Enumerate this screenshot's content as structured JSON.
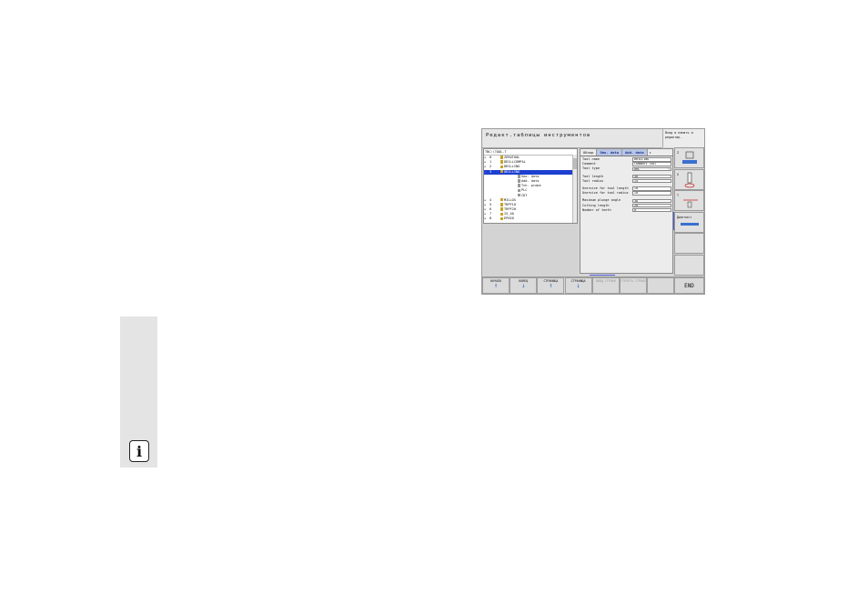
{
  "header": {
    "title": "Редакт.таблицы инструментов",
    "right_text": "Вход в память и редактир."
  },
  "tree": {
    "path": "TNC:\\TOOL.T",
    "rows": [
      {
        "expand": "+",
        "num": "0",
        "name": "ZEROTOOL",
        "icon": "tool",
        "selected": false
      },
      {
        "expand": "+",
        "num": "1",
        "name": "DRILLCOMPAL",
        "icon": "tool",
        "selected": false
      },
      {
        "expand": "+",
        "num": "2",
        "name": "DRILLING",
        "icon": "tool",
        "selected": false
      },
      {
        "expand": "-",
        "num": "3",
        "name": "DRILLING",
        "icon": "tool",
        "selected": true
      },
      {
        "expand": "",
        "num": "",
        "name": "Geo. data",
        "icon": "leaf",
        "selected": false
      },
      {
        "expand": "",
        "num": "",
        "name": "Add. data",
        "icon": "leaf",
        "selected": false
      },
      {
        "expand": "",
        "num": "",
        "name": "Tch. probe",
        "icon": "leaf",
        "selected": false
      },
      {
        "expand": "",
        "num": "",
        "name": "PLC",
        "icon": "leaf",
        "selected": false
      },
      {
        "expand": "",
        "num": "",
        "name": "CDT",
        "icon": "leaf",
        "selected": false
      },
      {
        "expand": "+",
        "num": "4",
        "name": "MILLOS",
        "icon": "tool",
        "selected": false
      },
      {
        "expand": "+",
        "num": "5",
        "name": "TRPF10",
        "icon": "tool",
        "selected": false
      },
      {
        "expand": "+",
        "num": "6",
        "name": "TRPF20",
        "icon": "tool",
        "selected": false
      },
      {
        "expand": "+",
        "num": "7",
        "name": "IS_40",
        "icon": "tool",
        "selected": false
      },
      {
        "expand": "+",
        "num": "8",
        "name": "EP020",
        "icon": "tool",
        "selected": false
      }
    ]
  },
  "detail": {
    "tabs": [
      {
        "label": "Обзор",
        "active": true
      },
      {
        "label": "Geo. data",
        "active": false
      },
      {
        "label": "Add. data",
        "active": false
      }
    ],
    "tab_more": "▸",
    "group1": [
      {
        "label": "Tool name",
        "value": "DRILLING",
        "dropdown": false
      },
      {
        "label": "Comment",
        "value": "Comment Tool",
        "dropdown": false
      },
      {
        "label": "Tool type",
        "value": "DRL",
        "dropdown": true
      }
    ],
    "group2": [
      {
        "label": "Tool length",
        "value": "40"
      },
      {
        "label": "Tool radius",
        "value": "+5"
      }
    ],
    "group3": [
      {
        "label": "Oversize for tool length",
        "value": "+0"
      },
      {
        "label": "Oversize for tool radius",
        "value": "+0"
      }
    ],
    "group4": [
      {
        "label": "Maximum plunge angle",
        "value": "30"
      },
      {
        "label": "Cutting length",
        "value": "20"
      },
      {
        "label": "Number of teeth",
        "value": "0"
      }
    ]
  },
  "right_softkeys": [
    {
      "label": "Z"
    },
    {
      "label": "X"
    },
    {
      "label": "T"
    },
    {
      "label": "Диагност"
    },
    {
      "label": ""
    },
    {
      "label": ""
    }
  ],
  "bottom_softkeys": [
    {
      "label": "НАЧАЛО",
      "arrow": "up",
      "disabled": false
    },
    {
      "label": "КОНЕЦ",
      "arrow": "down",
      "disabled": false
    },
    {
      "label": "СТРАНИЦА",
      "arrow": "up",
      "disabled": false
    },
    {
      "label": "СТРАНИЦА",
      "arrow": "down",
      "disabled": false
    },
    {
      "label": "ВВОД СТРОКИ",
      "arrow": "",
      "disabled": true
    },
    {
      "label": "СТЕРЕТЬ СТРОКУ",
      "arrow": "",
      "disabled": true
    },
    {
      "label": "",
      "arrow": "",
      "disabled": false
    }
  ],
  "end_key": "END",
  "info_icon": "i",
  "colors": {
    "selection": "#1c3fd0",
    "tab_inactive": "#b8c6e6",
    "arrow": "#2a62c8"
  }
}
